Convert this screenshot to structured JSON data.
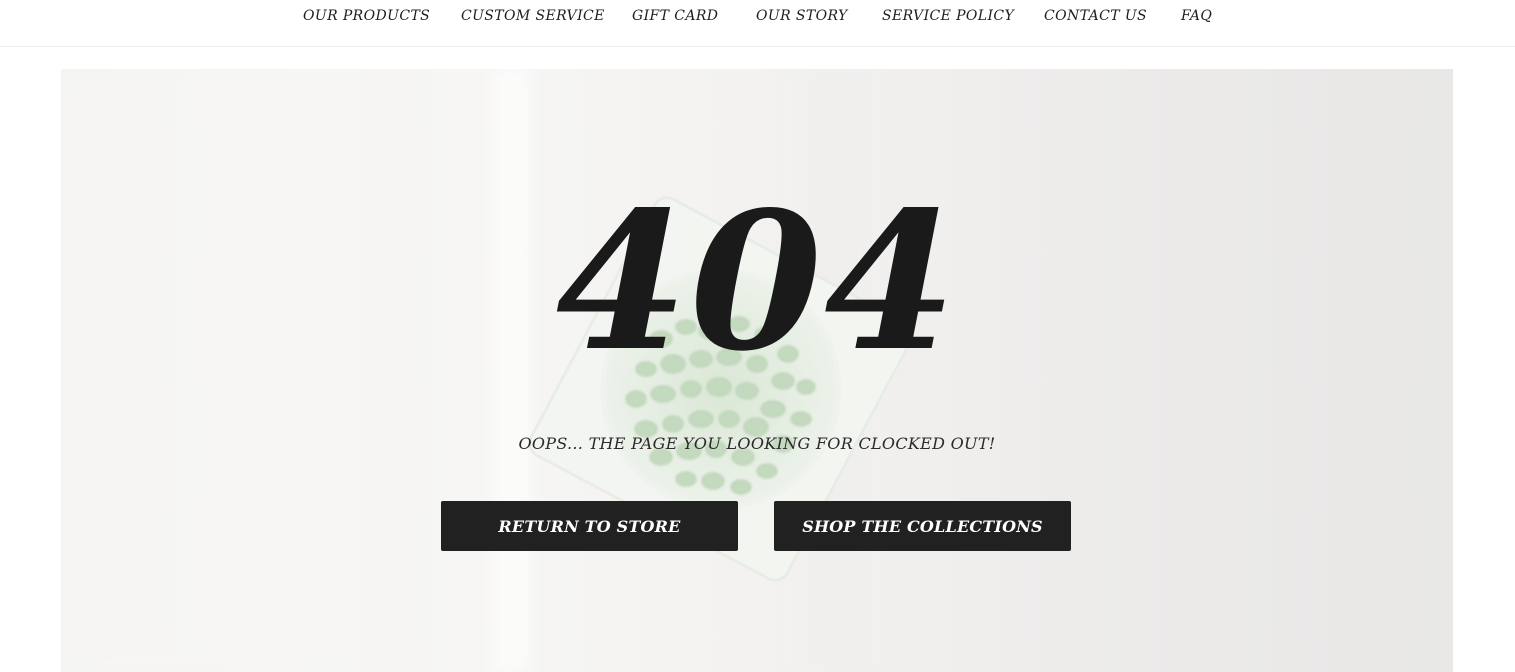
{
  "nav": {
    "items": [
      {
        "label": "OUR PRODUCTS"
      },
      {
        "label": "CUSTOM SERVICE"
      },
      {
        "label": "GIFT CARD"
      },
      {
        "label": "OUR STORY"
      },
      {
        "label": "SERVICE POLICY"
      },
      {
        "label": "CONTACT US"
      },
      {
        "label": "FAQ"
      }
    ]
  },
  "hero": {
    "code": "404",
    "message": "OOPS... THE PAGE YOU LOOKING FOR CLOCKED OUT!",
    "buttons": {
      "return_label": "RETURN TO STORE",
      "shop_label": "SHOP THE COLLECTIONS"
    }
  },
  "colors": {
    "button_bg": "#212121",
    "button_text": "#ffffff",
    "text": "#1a1a1a",
    "pebbles": "#a8c9a0"
  }
}
